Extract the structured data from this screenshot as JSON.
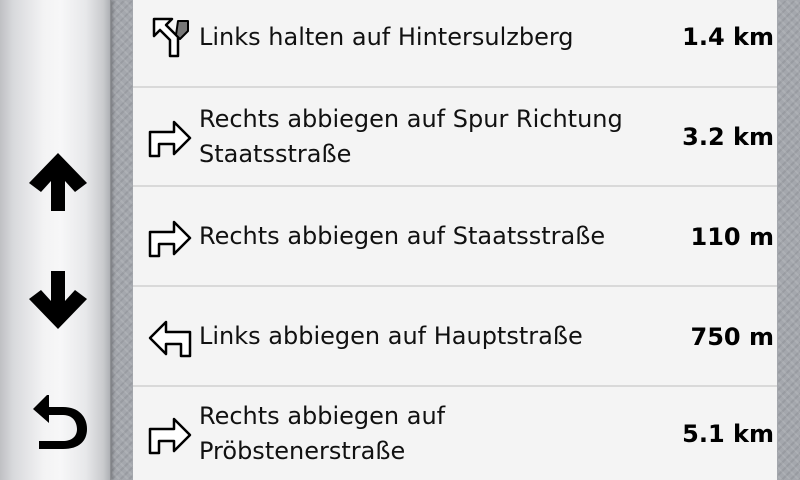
{
  "sidebar": {
    "up_icon": "arrow-up-icon",
    "down_icon": "arrow-down-icon",
    "back_icon": "back-arrow-icon"
  },
  "turns": [
    {
      "instruction": "Links halten auf Hintersulzberg",
      "distance": "1.4 km",
      "icon": "keep-left-icon"
    },
    {
      "instruction": "Rechts abbiegen auf Spur Richtung Staatsstraße",
      "distance": "3.2 km",
      "icon": "turn-right-icon"
    },
    {
      "instruction": "Rechts abbiegen auf Staatsstraße",
      "distance": "110 m",
      "icon": "turn-right-icon"
    },
    {
      "instruction": "Links abbiegen auf Hauptstraße",
      "distance": "750 m",
      "icon": "turn-left-icon"
    },
    {
      "instruction": "Rechts abbiegen auf Pröbstenerstraße",
      "distance": "5.1 km",
      "icon": "turn-right-icon"
    }
  ],
  "colors": {
    "list_background": "#f4f4f4",
    "divider": "#d9d9d9",
    "text": "#111111"
  }
}
